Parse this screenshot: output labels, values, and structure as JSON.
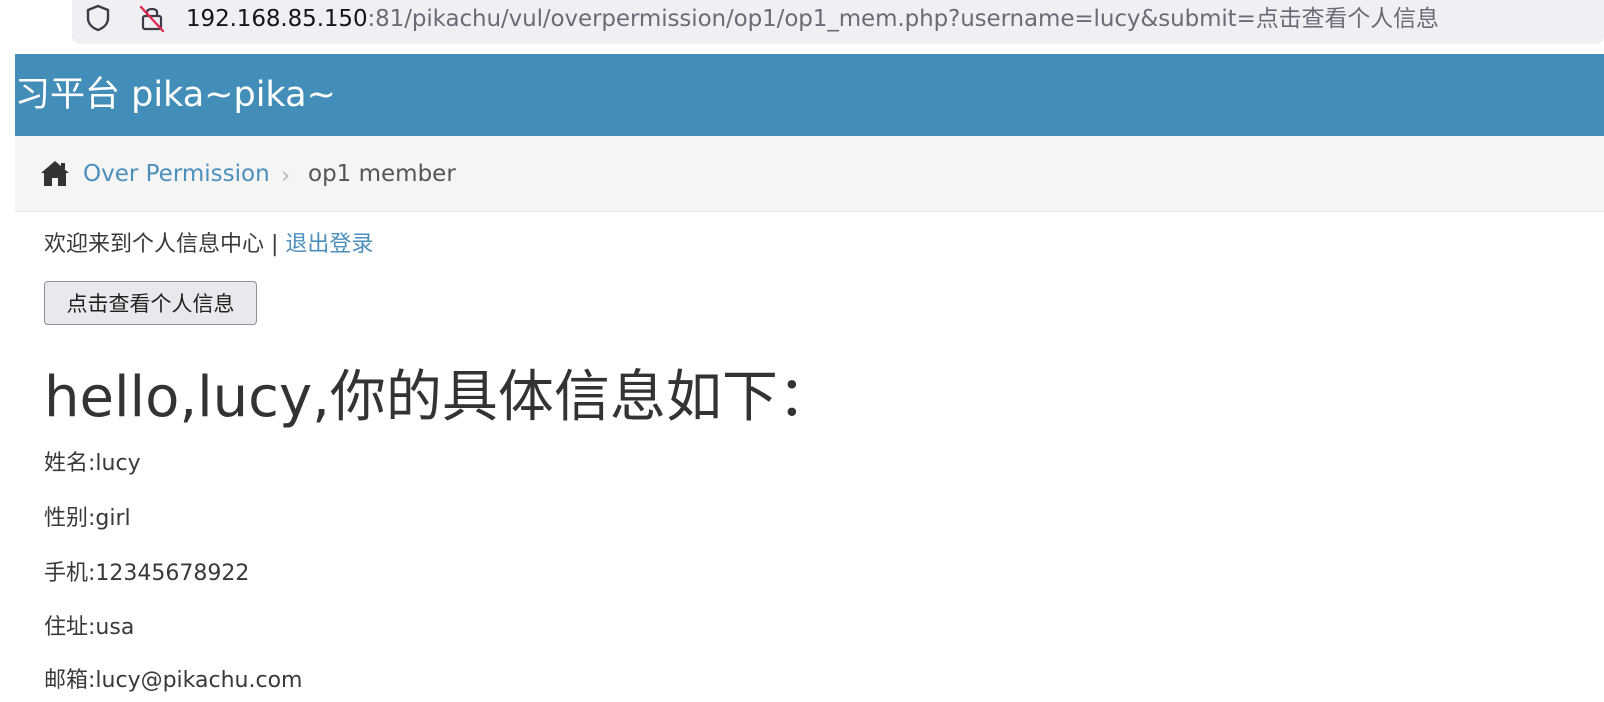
{
  "browser": {
    "url_host": "192.168.85.150",
    "url_path": ":81/pikachu/vul/overpermission/op1/op1_mem.php?username=lucy&submit=点击查看个人信息",
    "icons": [
      "shield-icon",
      "insecure-lock-icon"
    ]
  },
  "navbar": {
    "brand": "习平台 pika~pika~",
    "color": "#438eb9"
  },
  "breadcrumb": {
    "home_icon": "home-icon",
    "link": "Over Permission",
    "separator": "›",
    "active": "op1 member"
  },
  "main": {
    "welcome_text": "欢迎来到个人信息中心 | ",
    "logout_label": "退出登录",
    "view_button_label": "点击查看个人信息",
    "heading": "hello,lucy,你的具体信息如下：",
    "info": [
      "姓名:lucy",
      "性别:girl",
      "手机:12345678922",
      "住址:usa",
      "邮箱:lucy@pikachu.com"
    ]
  }
}
